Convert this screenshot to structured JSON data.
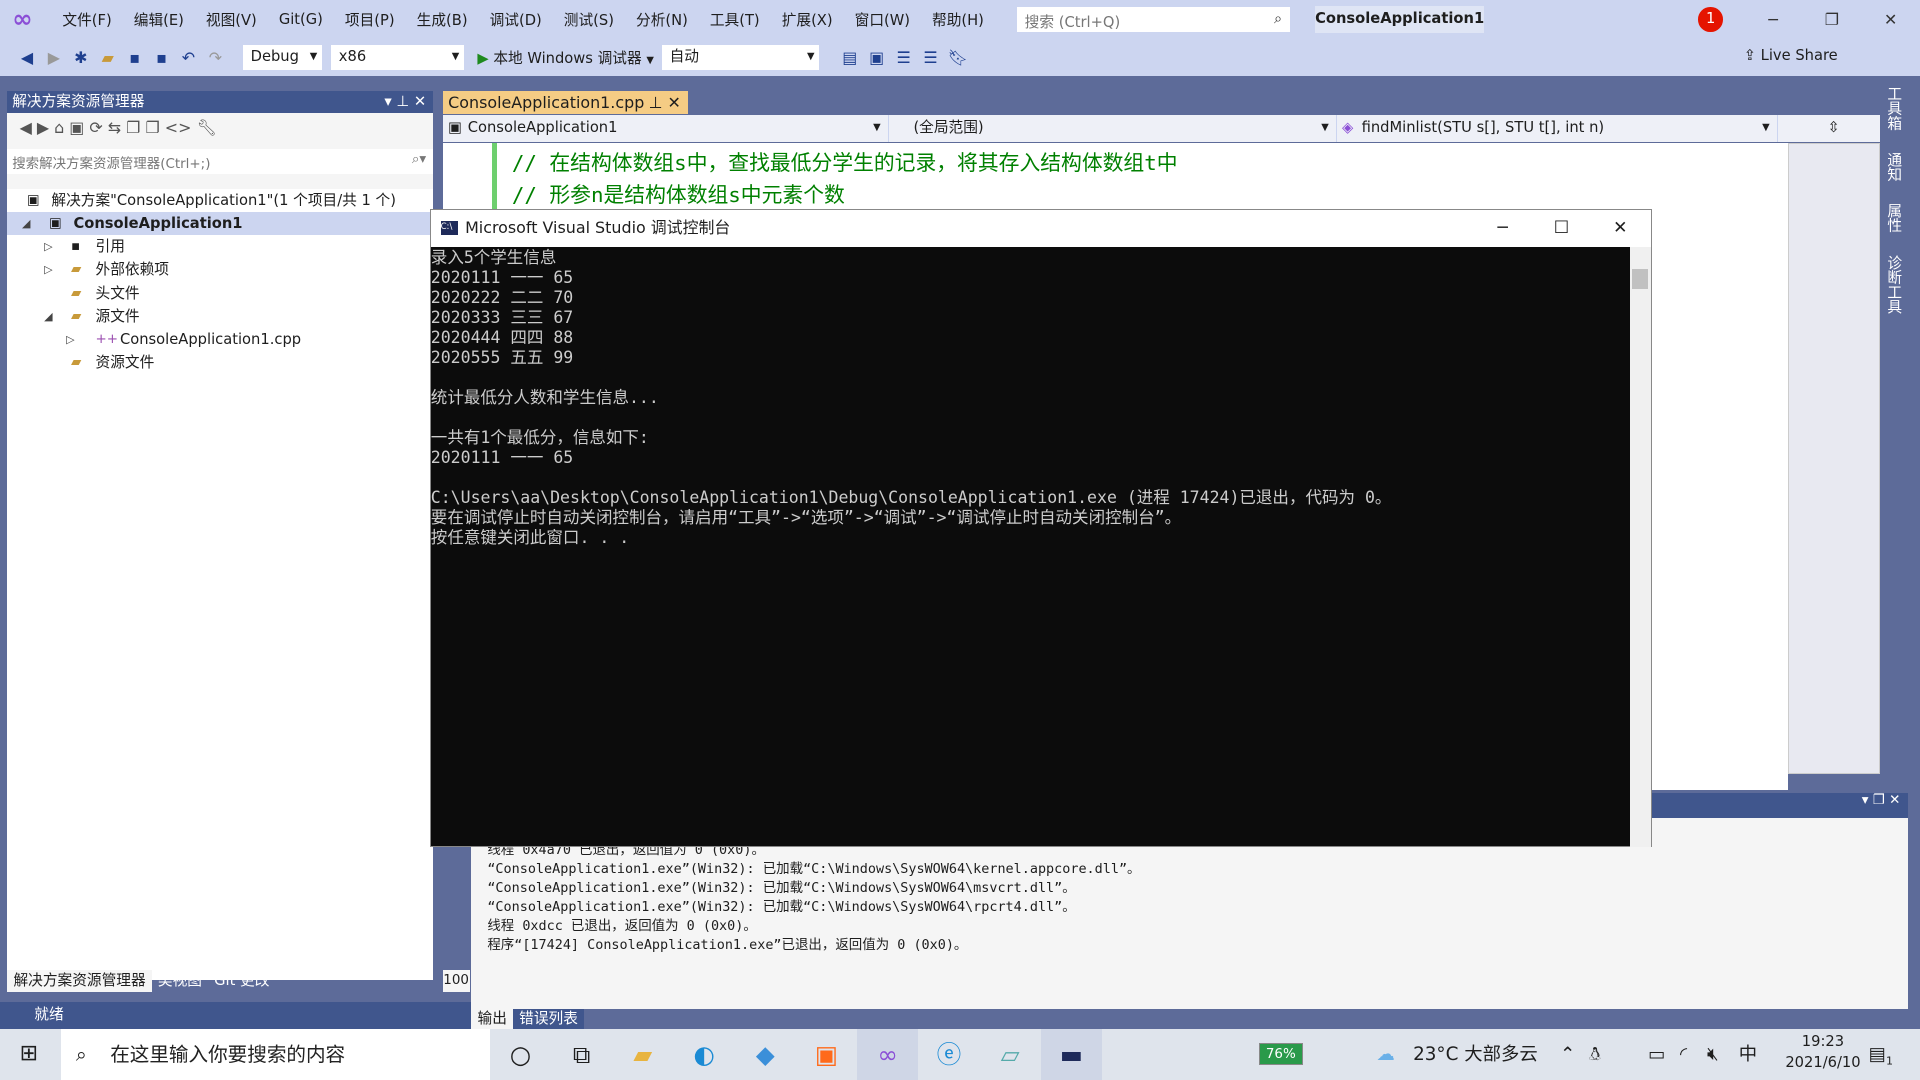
{
  "menubar": {
    "items": [
      "文件(F)",
      "编辑(E)",
      "视图(V)",
      "Git(G)",
      "项目(P)",
      "生成(B)",
      "调试(D)",
      "测试(S)",
      "分析(N)",
      "工具(T)",
      "扩展(X)",
      "窗口(W)",
      "帮助(H)"
    ],
    "search_placeholder": "搜索 (Ctrl+Q)",
    "solution_title": "ConsoleApplication1",
    "notification_count": "1"
  },
  "toolbar": {
    "config": "Debug",
    "platform": "x86",
    "run_label": "本地 Windows 调试器",
    "auto": "自动",
    "live_share": "Live Share"
  },
  "solution_explorer": {
    "title": "解决方案资源管理器",
    "search_placeholder": "搜索解决方案资源管理器(Ctrl+;)",
    "tree": [
      "解决方案\"ConsoleApplication1\"(1 个项目/共 1 个)",
      "ConsoleApplication1",
      "引用",
      "外部依赖项",
      "头文件",
      "源文件",
      "ConsoleApplication1.cpp",
      "资源文件"
    ],
    "tabs": [
      "解决方案资源管理器",
      "类视图",
      "Git 更改"
    ]
  },
  "editor": {
    "tab": "ConsoleApplication1.cpp",
    "nav_project": "ConsoleApplication1",
    "nav_scope": "(全局范围)",
    "nav_function": "findMinlist(STU s[], STU t[], int n)",
    "code_lines": [
      "// 在结构体数组s中，查找最低分学生的记录，将其存入结构体数组t中",
      "// 形参n是结构体数组s中元素个数"
    ],
    "zoom": "100"
  },
  "side_tabs": [
    "工具箱",
    "通知",
    "属性",
    "诊断工具"
  ],
  "console": {
    "title": "Microsoft Visual Studio 调试控制台",
    "lines": [
      "录入5个学生信息",
      "2020111 一一 65",
      "2020222 二二 70",
      "2020333 三三 67",
      "2020444 四四 88",
      "2020555 五五 99",
      "",
      "统计最低分人数和学生信息...",
      "",
      "一共有1个最低分，信息如下:",
      "2020111 一一 65",
      "",
      "C:\\Users\\aa\\Desktop\\ConsoleApplication1\\Debug\\ConsoleApplication1.exe (进程 17424)已退出，代码为 0。",
      "要在调试停止时自动关闭控制台，请启用“工具”->“选项”->“调试”->“调试停止时自动关闭控制台”。",
      "按任意键关闭此窗口. . ."
    ]
  },
  "output": {
    "lines": [
      "线程 0x4a70 已退出，返回值为 0 (0x0)。",
      "“ConsoleApplication1.exe”(Win32): 已加载“C:\\Windows\\SysWOW64\\kernel.appcore.dll”。",
      "“ConsoleApplication1.exe”(Win32): 已加载“C:\\Windows\\SysWOW64\\msvcrt.dll”。",
      "“ConsoleApplication1.exe”(Win32): 已加载“C:\\Windows\\SysWOW64\\rpcrt4.dll”。",
      "线程 0xdcc 已退出，返回值为 0 (0x0)。",
      "程序“[17424] ConsoleApplication1.exe”已退出，返回值为 0 (0x0)。"
    ],
    "tabs": [
      "输出",
      "错误列表"
    ]
  },
  "status": {
    "text": "就绪"
  },
  "taskbar": {
    "search_placeholder": "在这里输入你要搜索的内容",
    "battery": "76%",
    "weather": "23°C 大部多云",
    "ime": "中",
    "time": "19:23",
    "date": "2021/6/10",
    "notif_count": "1"
  }
}
